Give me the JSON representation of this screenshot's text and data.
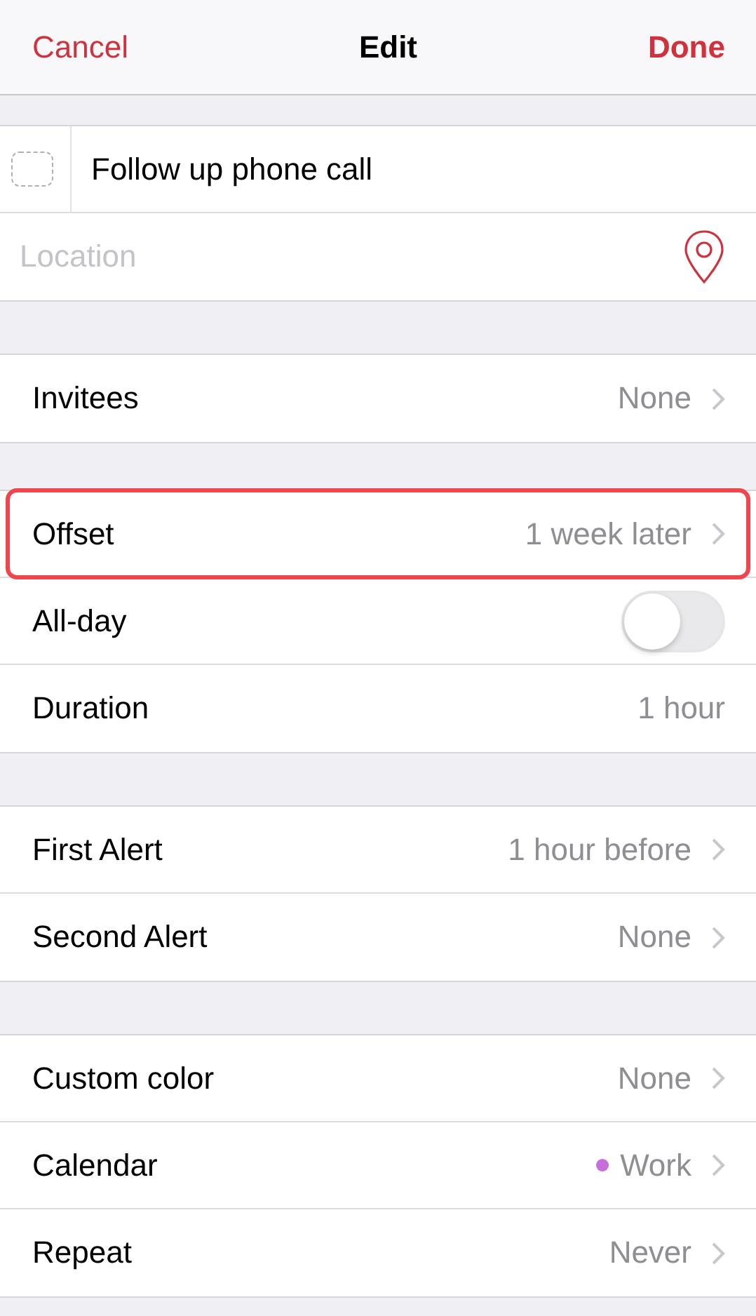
{
  "nav_bar": {
    "cancel": "Cancel",
    "title": "Edit",
    "done": "Done"
  },
  "sections": [
    {
      "rows": [
        {
          "kind": "title",
          "text": "Follow up phone call",
          "checked": false
        },
        {
          "kind": "location",
          "placeholder": "Location"
        }
      ]
    },
    {
      "rows": [
        {
          "kind": "nav",
          "label": "Invitees",
          "value": "None"
        }
      ]
    },
    {
      "rows": [
        {
          "kind": "nav",
          "label": "Offset",
          "value": "1 week later",
          "highlighted": true
        },
        {
          "kind": "toggle",
          "label": "All-day",
          "on": false
        },
        {
          "kind": "value",
          "label": "Duration",
          "value": "1 hour"
        }
      ]
    },
    {
      "rows": [
        {
          "kind": "nav",
          "label": "First Alert",
          "value": "1 hour before"
        },
        {
          "kind": "nav",
          "label": "Second Alert",
          "value": "None"
        }
      ]
    },
    {
      "rows": [
        {
          "kind": "nav",
          "label": "Custom color",
          "value": "None"
        },
        {
          "kind": "nav",
          "label": "Calendar",
          "value": "Work",
          "color": "#c86edc"
        },
        {
          "kind": "nav",
          "label": "Repeat",
          "value": "Never"
        }
      ]
    }
  ]
}
